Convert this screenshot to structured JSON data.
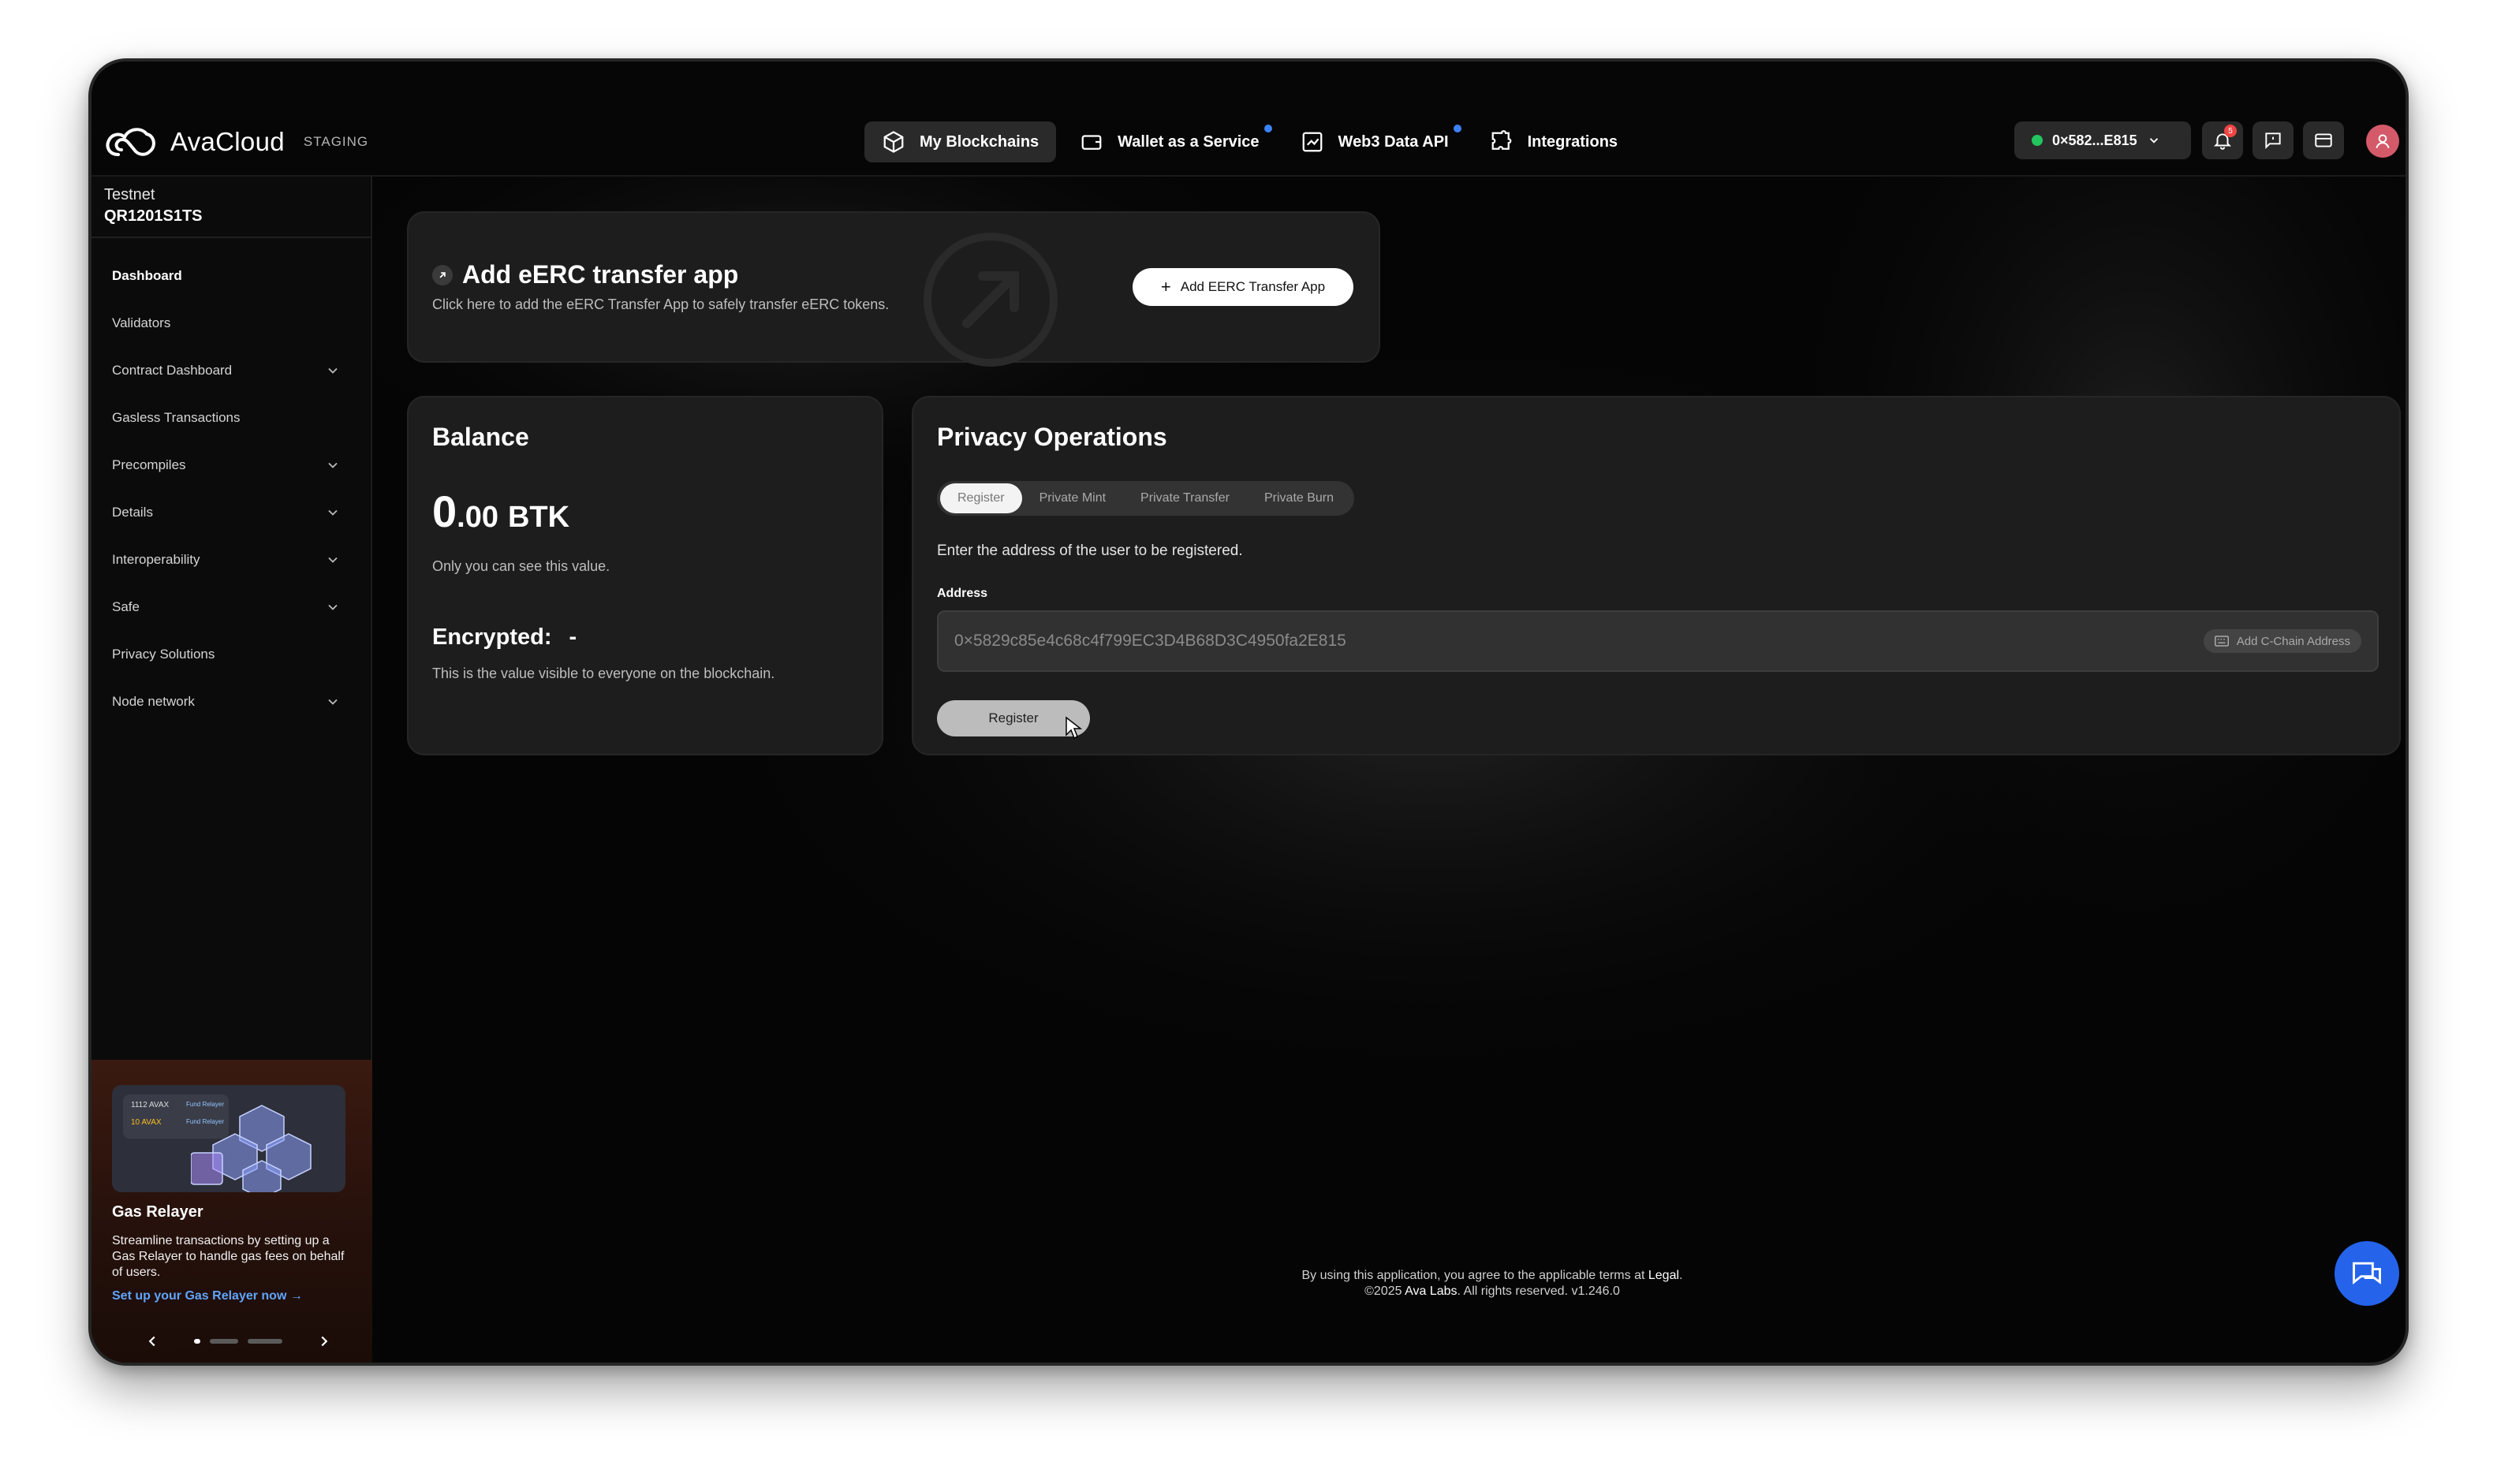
{
  "app": {
    "name": "AvaCloud",
    "env": "STAGING"
  },
  "nav": [
    {
      "label": "My Blockchains",
      "icon": "cube-icon",
      "active": true,
      "dot": false
    },
    {
      "label": "Wallet as a Service",
      "icon": "wallet-icon",
      "active": false,
      "dot": true
    },
    {
      "label": "Web3 Data API",
      "icon": "chart-icon",
      "active": false,
      "dot": true
    },
    {
      "label": "Integrations",
      "icon": "puzzle-icon",
      "active": false,
      "dot": false
    }
  ],
  "account": {
    "address": "0×582...E815",
    "status_color": "#22c55e"
  },
  "notifications": {
    "count": "5"
  },
  "sidebar": {
    "network": "Testnet",
    "chain": "QR1201S1TS",
    "items": [
      {
        "label": "Dashboard"
      },
      {
        "label": "Validators"
      },
      {
        "label": "Contract Dashboard"
      },
      {
        "label": "Gasless Transactions"
      },
      {
        "label": "Precompiles"
      },
      {
        "label": "Details"
      },
      {
        "label": "Interoperability"
      },
      {
        "label": "Safe"
      },
      {
        "label": "Privacy Solutions"
      },
      {
        "label": "Node network"
      }
    ]
  },
  "promo": {
    "title": "Gas Relayer",
    "description": "Streamline transactions by setting up a Gas Relayer to handle gas fees on behalf of users.",
    "link": "Set up your Gas Relayer now →",
    "img_text_1": "1112 AVAX",
    "img_text_2": "10 AVAX",
    "img_tag_1": "Fund Relayer",
    "img_tag_2": "Fund Relayer"
  },
  "app_card": {
    "title": "Add eERC transfer app",
    "subtitle": "Click here to add the eERC Transfer App to safely transfer eERC tokens.",
    "button": "Add EERC Transfer App"
  },
  "balance": {
    "title": "Balance",
    "int": "0",
    "dec": ".00",
    "unit": "BTK",
    "note": "Only you can see this value.",
    "encrypted_label": "Encrypted:",
    "encrypted_value": "-",
    "encrypted_note": "This is the value visible to everyone on the blockchain."
  },
  "privacy": {
    "title": "Privacy Operations",
    "tabs": [
      "Register",
      "Private Mint",
      "Private Transfer",
      "Private Burn"
    ],
    "instruction": "Enter the address of the user to be registered.",
    "address_label": "Address",
    "address_placeholder": "0×5829c85e4c68c4f799EC3D4B68D3C4950fa2E815",
    "add_c_chain": "Add C-Chain Address",
    "register_button": "Register"
  },
  "footer": {
    "line1_prefix": "By using this application, you agree to the applicable terms at",
    "legal": "Legal",
    "line2_prefix": "©2025",
    "company": "Ava Labs",
    "line2_suffix": "All rights reserved.  v1.246.0"
  }
}
